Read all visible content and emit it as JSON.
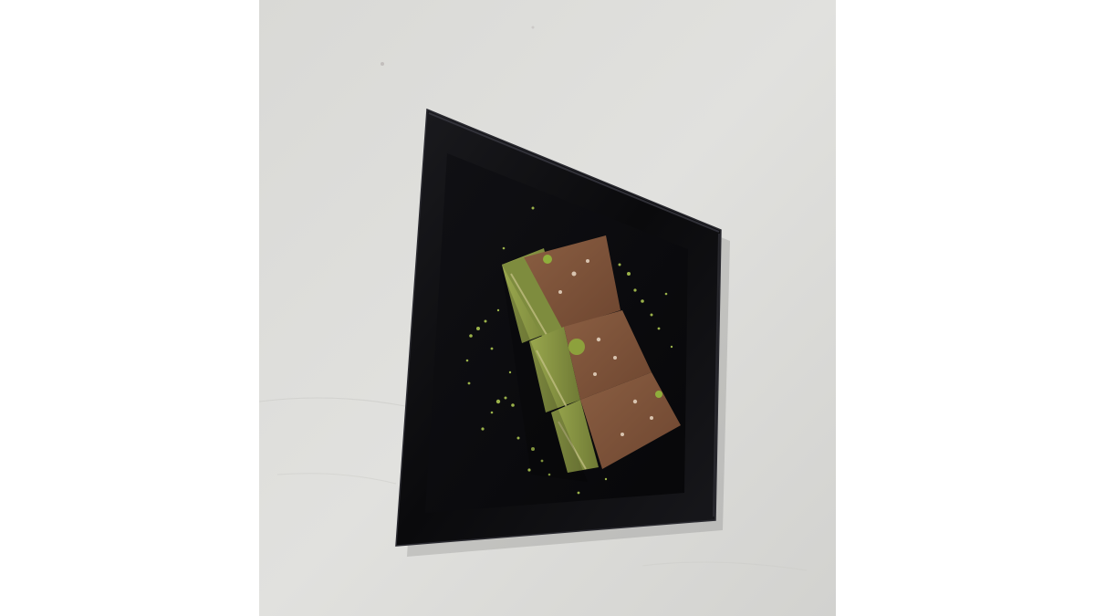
{
  "image": {
    "subject": "dessert-slices-on-black-plate",
    "background_color": "#ffffff",
    "surface_color": "#dcdcda",
    "plate_color": "#0b0b0d",
    "cake_top_color": "#7a5238",
    "cake_layer_color": "#8c9a45",
    "garnish_color": "#9bb24a",
    "slice_count": 3
  }
}
